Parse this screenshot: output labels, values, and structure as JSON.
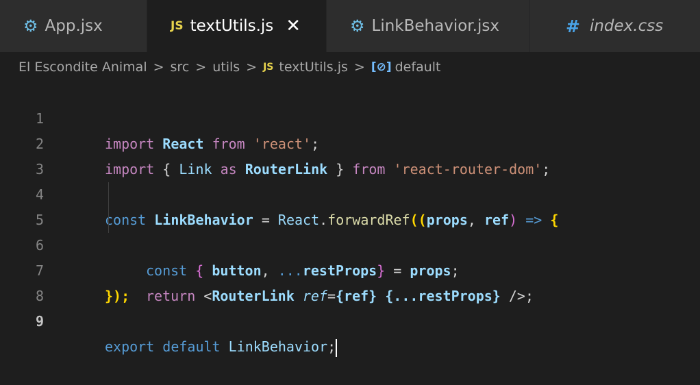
{
  "tabs": [
    {
      "label": "App.jsx",
      "icon": "react-gear-icon",
      "active": false
    },
    {
      "label": "textUtils.js",
      "icon": "javascript-icon",
      "active": true,
      "close": "✕"
    },
    {
      "label": "LinkBehavior.jsx",
      "icon": "react-gear-icon",
      "active": false
    },
    {
      "label": "index.css",
      "icon": "css-hash-icon",
      "active": false
    }
  ],
  "icons": {
    "js": "JS",
    "hash": "#",
    "gear": "⚙",
    "symbol": "[⊘]"
  },
  "breadcrumb": {
    "items": [
      "El Escondite Animal",
      "src",
      "utils",
      "textUtils.js",
      "default"
    ],
    "separator": ">"
  },
  "editor": {
    "line_numbers": [
      "1",
      "2",
      "3",
      "4",
      "5",
      "6",
      "7",
      "8",
      "9"
    ],
    "active_line": "9",
    "code": {
      "l1": {
        "kw": "import",
        "name": "React",
        "from": "from",
        "str": "'react'",
        "end": ";"
      },
      "l2": {
        "kw": "import",
        "open": "{",
        "name1": "Link",
        "as": "as",
        "name2": "RouterLink",
        "close": "}",
        "from": "from",
        "str": "'react-router-dom'",
        "end": ";"
      },
      "l4": {
        "kw": "const",
        "name": "LinkBehavior",
        "eq": "=",
        "obj": "React",
        "dot": ".",
        "fn": "forwardRef",
        "p1": "((",
        "arg1": "props",
        "comma": ",",
        "arg2": "ref",
        "p2": ")",
        "arrow": "=>",
        "brace": "{"
      },
      "l5": {
        "kw": "const",
        "open": "{",
        "a": "button",
        "comma": ",",
        "spread": "...",
        "b": "restProps",
        "close": "}",
        "eq": "=",
        "c": "props",
        "end": ";"
      },
      "l6": {
        "kw": "return",
        "lt": "<",
        "tag": "RouterLink",
        "attr": "ref",
        "eq": "=",
        "v1": "{ref}",
        "v2": "{...restProps}",
        "end": "/>;"
      },
      "l7": {
        "text": "});"
      },
      "l9": {
        "kw": "export",
        "kw2": "default",
        "name": "LinkBehavior",
        "end": ";"
      }
    }
  },
  "colors": {
    "background": "#1e1e1e",
    "tab_bar": "#252526",
    "keyword": "#c586c0",
    "string": "#ce9178",
    "variable": "#9cdcfe",
    "function": "#dcdcaa",
    "tag": "#4ec9b0",
    "js_icon": "#e8d44d"
  }
}
